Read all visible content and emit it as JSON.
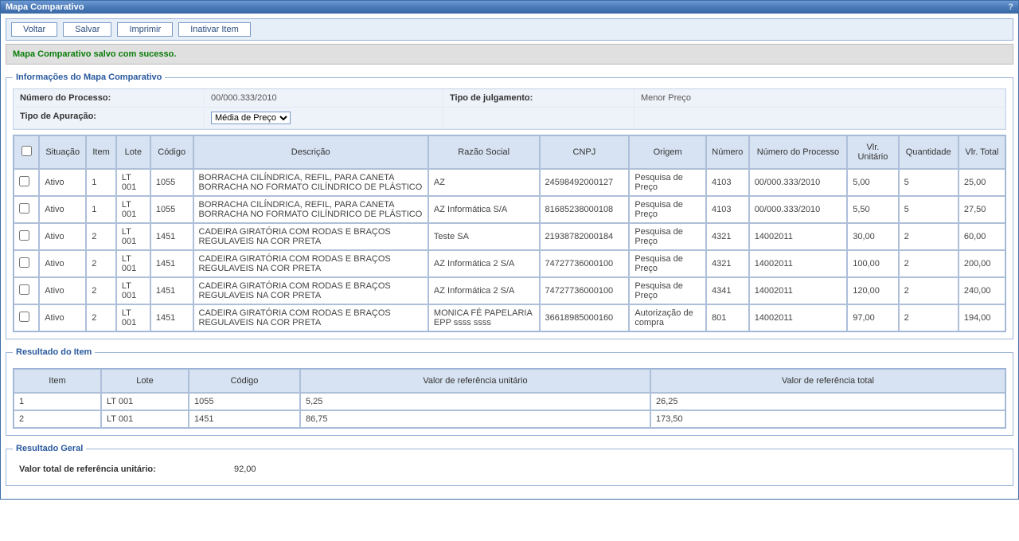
{
  "window": {
    "title": "Mapa Comparativo"
  },
  "toolbar": {
    "voltar": "Voltar",
    "salvar": "Salvar",
    "imprimir": "Imprimir",
    "inativar": "Inativar Item"
  },
  "message": "Mapa Comparativo salvo com sucesso.",
  "info": {
    "legend": "Informações do Mapa Comparativo",
    "numero_processo_label": "Número do Processo:",
    "numero_processo_value": "00/000.333/2010",
    "tipo_julgamento_label": "Tipo de julgamento:",
    "tipo_julgamento_value": "Menor Preço",
    "tipo_apuracao_label": "Tipo de Apuração:",
    "tipo_apuracao_value": "Média de Preço"
  },
  "table": {
    "headers": {
      "situacao": "Situação",
      "item": "Item",
      "lote": "Lote",
      "codigo": "Código",
      "descricao": "Descrição",
      "razao": "Razão Social",
      "cnpj": "CNPJ",
      "origem": "Origem",
      "numero": "Número",
      "num_processo": "Número do Processo",
      "vlr_unitario": "Vlr. Unitário",
      "quantidade": "Quantidade",
      "vlr_total": "Vlr. Total"
    },
    "rows": [
      {
        "situacao": "Ativo",
        "item": "1",
        "lote": "LT 001",
        "codigo": "1055",
        "descricao": "BORRACHA CILÍNDRICA, REFIL, PARA CANETA BORRACHA NO FORMATO CILÍNDRICO DE PLÁSTICO",
        "razao": "AZ",
        "cnpj": "24598492000127",
        "origem": "Pesquisa de Preço",
        "numero": "4103",
        "num_processo": "00/000.333/2010",
        "vlr_unitario": "5,00",
        "quantidade": "5",
        "vlr_total": "25,00"
      },
      {
        "situacao": "Ativo",
        "item": "1",
        "lote": "LT 001",
        "codigo": "1055",
        "descricao": "BORRACHA CILÍNDRICA, REFIL, PARA CANETA BORRACHA NO FORMATO CILÍNDRICO DE PLÁSTICO",
        "razao": "AZ Informática S/A",
        "cnpj": "81685238000108",
        "origem": "Pesquisa de Preço",
        "numero": "4103",
        "num_processo": "00/000.333/2010",
        "vlr_unitario": "5,50",
        "quantidade": "5",
        "vlr_total": "27,50"
      },
      {
        "situacao": "Ativo",
        "item": "2",
        "lote": "LT 001",
        "codigo": "1451",
        "descricao": "CADEIRA GIRATÓRIA COM RODAS E BRAÇOS REGULAVEIS NA COR PRETA",
        "razao": "Teste SA",
        "cnpj": "21938782000184",
        "origem": "Pesquisa de Preço",
        "numero": "4321",
        "num_processo": "14002011",
        "vlr_unitario": "30,00",
        "quantidade": "2",
        "vlr_total": "60,00"
      },
      {
        "situacao": "Ativo",
        "item": "2",
        "lote": "LT 001",
        "codigo": "1451",
        "descricao": "CADEIRA GIRATÓRIA COM RODAS E BRAÇOS REGULAVEIS NA COR PRETA",
        "razao": "AZ Informática 2 S/A",
        "cnpj": "74727736000100",
        "origem": "Pesquisa de Preço",
        "numero": "4321",
        "num_processo": "14002011",
        "vlr_unitario": "100,00",
        "quantidade": "2",
        "vlr_total": "200,00"
      },
      {
        "situacao": "Ativo",
        "item": "2",
        "lote": "LT 001",
        "codigo": "1451",
        "descricao": "CADEIRA GIRATÓRIA COM RODAS E BRAÇOS REGULAVEIS NA COR PRETA",
        "razao": "AZ Informática 2 S/A",
        "cnpj": "74727736000100",
        "origem": "Pesquisa de Preço",
        "numero": "4341",
        "num_processo": "14002011",
        "vlr_unitario": "120,00",
        "quantidade": "2",
        "vlr_total": "240,00"
      },
      {
        "situacao": "Ativo",
        "item": "2",
        "lote": "LT 001",
        "codigo": "1451",
        "descricao": "CADEIRA GIRATÓRIA COM RODAS E BRAÇOS REGULAVEIS NA COR PRETA",
        "razao": "MONICA FÉ PAPELARIA EPP ssss ssss",
        "cnpj": "36618985000160",
        "origem": "Autorização de compra",
        "numero": "801",
        "num_processo": "14002011",
        "vlr_unitario": "97,00",
        "quantidade": "2",
        "vlr_total": "194,00"
      }
    ]
  },
  "resultado_item": {
    "legend": "Resultado do Item",
    "headers": {
      "item": "Item",
      "lote": "Lote",
      "codigo": "Código",
      "val_ref_unit": "Valor de referência unitário",
      "val_ref_total": "Valor de referência total"
    },
    "rows": [
      {
        "item": "1",
        "lote": "LT 001",
        "codigo": "1055",
        "val_ref_unit": "5,25",
        "val_ref_total": "26,25"
      },
      {
        "item": "2",
        "lote": "LT 001",
        "codigo": "1451",
        "val_ref_unit": "86,75",
        "val_ref_total": "173,50"
      }
    ]
  },
  "resultado_geral": {
    "legend": "Resultado Geral",
    "valor_total_unit_label": "Valor total de referência unitário:",
    "valor_total_unit_value": "92,00"
  }
}
